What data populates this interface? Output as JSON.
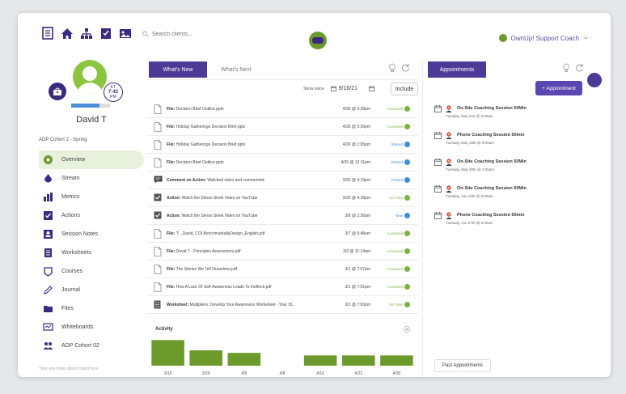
{
  "header": {
    "search_placeholder": "Search clients...",
    "coach_name": "OwnUp! Support Coach"
  },
  "profile": {
    "name": "David T",
    "timezone_label": "ET",
    "time": "7:42",
    "meridiem": "PM",
    "progress_fraction": 0.72,
    "cohort": "ADP Cohort 2 - Spring",
    "footer_hint": "Type any notes about David here"
  },
  "sidebar": {
    "items": [
      {
        "label": "Overview",
        "icon": "overview-icon",
        "active": true
      },
      {
        "label": "Stream",
        "icon": "stream-icon"
      },
      {
        "label": "Metrics",
        "icon": "metrics-icon"
      },
      {
        "label": "Actions",
        "icon": "actions-icon"
      },
      {
        "label": "Session Notes",
        "icon": "session-notes-icon"
      },
      {
        "label": "Worksheets",
        "icon": "worksheets-icon"
      },
      {
        "label": "Courses",
        "icon": "courses-icon"
      },
      {
        "label": "Journal",
        "icon": "journal-icon"
      },
      {
        "label": "Files",
        "icon": "files-icon"
      },
      {
        "label": "Whiteboards",
        "icon": "whiteboards-icon"
      },
      {
        "label": "ADP Cohort 02",
        "icon": "group-icon"
      }
    ]
  },
  "feed": {
    "tabs": [
      "What's New",
      "What's Next"
    ],
    "show_since_label": "Show since",
    "since_date": "9/16/21",
    "include_label": "Include",
    "rows": [
      {
        "type": "file",
        "kind": "File:",
        "text": "Decision Brief Outline.pptx",
        "date": "4/30 @ 5:28pm",
        "status": "Accessed",
        "color": "#7cb342"
      },
      {
        "type": "file",
        "kind": "File:",
        "text": "Holiday Gatherings Decision Brief.pptx",
        "date": "4/30 @ 5:26pm",
        "status": "Accessed",
        "color": "#7cb342"
      },
      {
        "type": "file",
        "kind": "File:",
        "text": "Holiday Gatherings Decision Brief.pptx",
        "date": "4/26 @ 1:05pm",
        "status": "Shared",
        "color": "#3d8fe0"
      },
      {
        "type": "file",
        "kind": "File:",
        "text": "Decision Brief Outline.pptx",
        "date": "4/26 @ 12:11pm",
        "status": "Shared",
        "color": "#3d8fe0"
      },
      {
        "type": "comment",
        "kind": "Comment on Action:",
        "text": "Watched video and commented",
        "date": "3/20 @ 4:19pm",
        "status": "Posted",
        "color": "#3d8fe0"
      },
      {
        "type": "action",
        "kind": "Action:",
        "text": "Watch the Simon Sinek Video on YouTube",
        "date": "3/20 @ 4:18pm",
        "status": "On Time",
        "color": "#7cb342"
      },
      {
        "type": "action",
        "kind": "Action:",
        "text": "Watch the Simon Sinek Video on YouTube",
        "date": "3/8 @ 2:36pm",
        "status": "New",
        "color": "#3d8fe0"
      },
      {
        "type": "file",
        "kind": "File:",
        "text": "T:        _David_COLBenchmarkallyDesign_English.pdf",
        "date": "3/7 @ 6:48am",
        "status": "Accessed",
        "color": "#7cb342"
      },
      {
        "type": "file",
        "kind": "File:",
        "text": "David T            - Principles Assessment.pdf",
        "date": "3/2 @ 11:14am",
        "status": "Accessed",
        "color": "#7cb342"
      },
      {
        "type": "file",
        "kind": "File:",
        "text": "The Stories We Tell Ourselves.pdf",
        "date": "3/1 @ 7:07pm",
        "status": "Accessed",
        "color": "#7cb342"
      },
      {
        "type": "file",
        "kind": "File:",
        "text": "How A Lack Of Self-Awareness Leads To Ineffecti.pdf",
        "date": "3/1 @ 7:01pm",
        "status": "Accessed",
        "color": "#7cb342"
      },
      {
        "type": "worksheet",
        "kind": "Worksheet:",
        "text": "Multipliers: Develop Your Awareness Worksheet - Your Ol...",
        "date": "3/1 @ 7:00pm",
        "status": "On Time",
        "color": "#7cb342"
      }
    ]
  },
  "activity": {
    "title": "Activity"
  },
  "chart_data": {
    "type": "bar",
    "categories": [
      "3/15",
      "3/29",
      "4/5",
      "4/8",
      "4/16",
      "4/23",
      "4/30"
    ],
    "values": [
      10,
      6,
      5,
      0,
      4,
      4,
      4
    ],
    "ylim": [
      0,
      12
    ],
    "color": "#6c9a2c",
    "grid": false
  },
  "appointments": {
    "tab_label": "Appointments",
    "add_label": "+ Appointment",
    "past_label": "Past Appointments",
    "items": [
      {
        "title": "On-Site Coaching Session 50Min",
        "date": "Tuesday, May 2nd @ 5:00am"
      },
      {
        "title": "Phone Coaching Session 50min",
        "date": "Tuesday, May 16th @ 9:00am"
      },
      {
        "title": "On-Site Coaching Session 50Min",
        "date": "Tuesday, May 30th @ 4:00am"
      },
      {
        "title": "On-Site Coaching Session 50Min",
        "date": "Tuesday, Jun 13th @ 5:00am"
      },
      {
        "title": "Phone Coaching Session 60min",
        "date": "Tuesday, Jun 27th @ 5:00am"
      }
    ]
  },
  "colors": {
    "brand_purple": "#4d3a96",
    "brand_green": "#6c9a2c"
  }
}
